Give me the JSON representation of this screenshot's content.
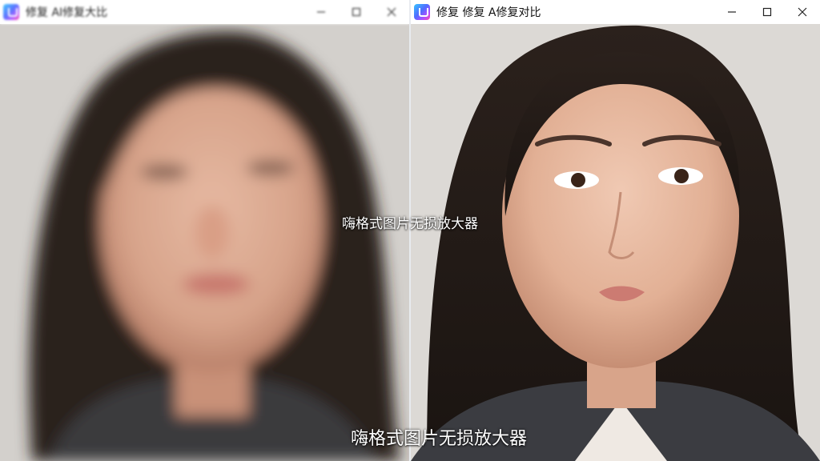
{
  "left_window": {
    "title": "修复 AI修复大比",
    "icon": "app-icon",
    "controls": [
      "minimize-icon",
      "maximize-icon",
      "close-icon"
    ]
  },
  "right_window": {
    "title": "修复  修复 A修复对比",
    "icon": "app-icon",
    "controls": [
      "minimize-icon",
      "maximize-icon",
      "close-icon"
    ]
  },
  "overlay": {
    "caption_middle": "嗨格式图片无损放大器",
    "caption_bottom": "嗨格式图片无损放大器"
  },
  "colors": {
    "titlebar_bg": "#ffffff",
    "divider": "#e8ebef",
    "caption_text": "#ffffff"
  }
}
